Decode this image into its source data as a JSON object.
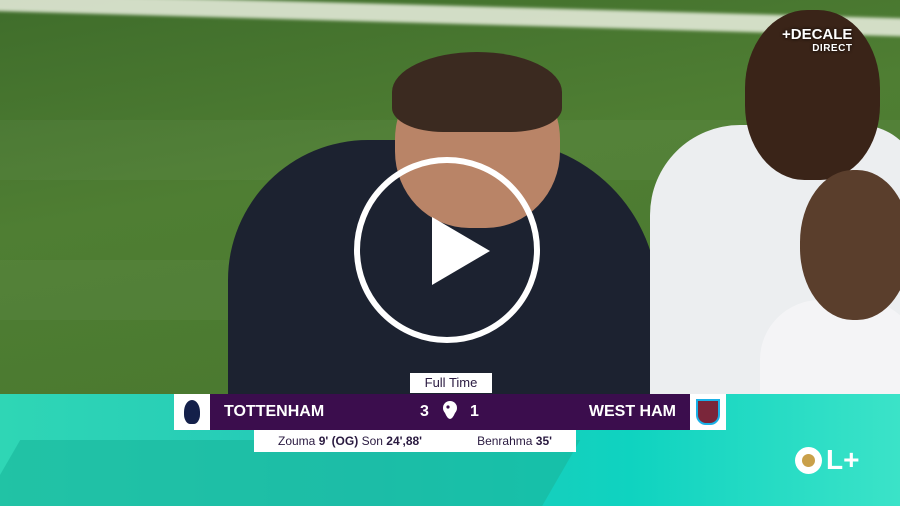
{
  "channel": {
    "name": "+DECALE",
    "sub": "DIRECT"
  },
  "match": {
    "status": "Full Time",
    "home": {
      "team": "TOTTENHAM",
      "score": "3",
      "scorers": "Zouma",
      "scorers_min": "9' (OG)",
      "scorers2": "Son",
      "scorers2_min": "24',88'"
    },
    "away": {
      "team": "WEST HAM",
      "score": "1",
      "scorers": "Benrahma",
      "scorers_min": "35'"
    }
  },
  "brand": {
    "label": "L+"
  },
  "colors": {
    "band": "#22c8b8",
    "bar": "#3b0d4d"
  },
  "icons": {
    "play": "play-icon",
    "league": "premier-league-icon"
  }
}
